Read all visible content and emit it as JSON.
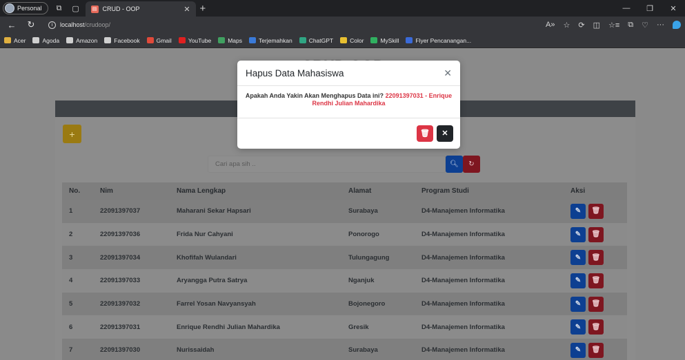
{
  "browser": {
    "profile_label": "Personal",
    "tab_title": "CRUD - OOP",
    "url_host": "localhost",
    "url_path": "/crudoop/",
    "bookmarks": [
      {
        "label": "Acer",
        "icon": "folder-icon",
        "color": "#e0b040"
      },
      {
        "label": "Agoda",
        "icon": "page-icon",
        "color": "#cfcfcf"
      },
      {
        "label": "Amazon",
        "icon": "page-icon",
        "color": "#cfcfcf"
      },
      {
        "label": "Facebook",
        "icon": "page-icon",
        "color": "#cfcfcf"
      },
      {
        "label": "Gmail",
        "icon": "gmail-icon",
        "color": "#e04a3a"
      },
      {
        "label": "YouTube",
        "icon": "youtube-icon",
        "color": "#e02020"
      },
      {
        "label": "Maps",
        "icon": "maps-icon",
        "color": "#40a060"
      },
      {
        "label": "Terjemahkan",
        "icon": "translate-icon",
        "color": "#3a7ad8"
      },
      {
        "label": "ChatGPT",
        "icon": "chatgpt-icon",
        "color": "#2fa583"
      },
      {
        "label": "Color",
        "icon": "color-icon",
        "color": "#e8c030"
      },
      {
        "label": "MySkill",
        "icon": "myskill-icon",
        "color": "#30b060"
      },
      {
        "label": "Flyer Pencanangan...",
        "icon": "flyer-icon",
        "color": "#3a6ad8"
      }
    ]
  },
  "page": {
    "title": "CRUD OOP",
    "add_label": "+",
    "search_placeholder": "Cari apa sih ..",
    "table": {
      "headers": [
        "No.",
        "Nim",
        "Nama Lengkap",
        "Alamat",
        "Program Studi",
        "Aksi"
      ],
      "rows": [
        [
          "1",
          "22091397037",
          "Maharani Sekar Hapsari",
          "Surabaya",
          "D4-Manajemen Informatika"
        ],
        [
          "2",
          "22091397036",
          "Frida Nur Cahyani",
          "Ponorogo",
          "D4-Manajemen Informatika"
        ],
        [
          "3",
          "22091397034",
          "Khofifah Wulandari",
          "Tulungagung",
          "D4-Manajemen Informatika"
        ],
        [
          "4",
          "22091397033",
          "Aryangga Putra Satrya",
          "Nganjuk",
          "D4-Manajemen Informatika"
        ],
        [
          "5",
          "22091397032",
          "Farrel Yosan Navyansyah",
          "Bojonegoro",
          "D4-Manajemen Informatika"
        ],
        [
          "6",
          "22091397031",
          "Enrique Rendhi Julian Mahardika",
          "Gresik",
          "D4-Manajemen Informatika"
        ],
        [
          "7",
          "22091397030",
          "Nurissaidah",
          "Surabaya",
          "D4-Manajemen Informatika"
        ]
      ]
    }
  },
  "modal": {
    "title": "Hapus Data Mahasiswa",
    "question": "Apakah Anda Yakin Akan Menghapus Data ini?",
    "highlight": "22091397031 - Enrique Rendhi Julian Mahardika"
  },
  "colors": {
    "danger": "#dc3545",
    "dark": "#212529",
    "primary_dimmed": "#0d3f91",
    "warning_dimmed": "#9a7a12"
  }
}
